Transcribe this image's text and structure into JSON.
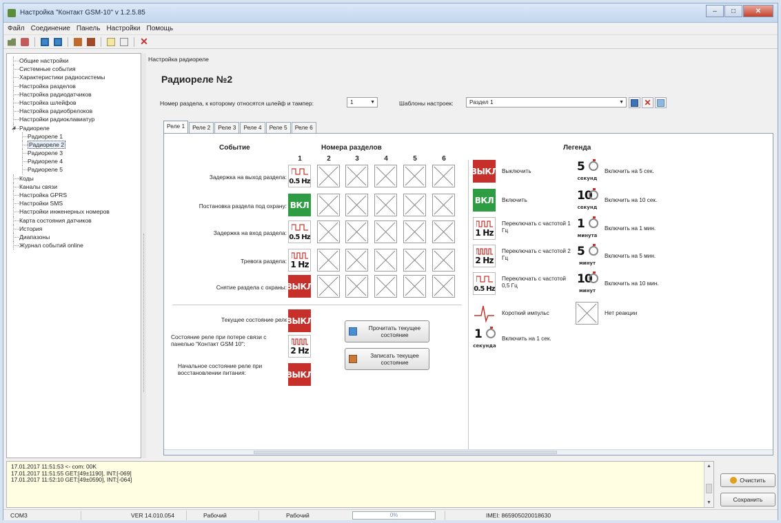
{
  "window": {
    "title": "Настройка \"Контакт GSM-10\" v 1.2.5.85"
  },
  "menu": [
    "Файл",
    "Соединение",
    "Панель",
    "Настройки",
    "Помощь"
  ],
  "toolbar_icons": [
    "open-icon",
    "save-icon",
    "read-icon",
    "write-icon",
    "read-all-icon",
    "write-all-icon",
    "copy-icon",
    "paste-icon",
    "delete-icon"
  ],
  "tree": [
    {
      "label": "Общие настройки",
      "level": 0
    },
    {
      "label": "Системные события",
      "level": 0
    },
    {
      "label": "Характеристики радиосистемы",
      "level": 0
    },
    {
      "label": "Настройка разделов",
      "level": 0
    },
    {
      "label": "Настройка радиодатчиков",
      "level": 0
    },
    {
      "label": "Настройка шлейфов",
      "level": 0
    },
    {
      "label": "Настройка радиобрелоков",
      "level": 0
    },
    {
      "label": "Настройки радиоклавиатур",
      "level": 0
    },
    {
      "label": "Радиореле",
      "level": 0,
      "expanded": true
    },
    {
      "label": "Радиореле 1",
      "level": 1
    },
    {
      "label": "Радиореле 2",
      "level": 1,
      "selected": true
    },
    {
      "label": "Радиореле 3",
      "level": 1
    },
    {
      "label": "Радиореле 4",
      "level": 1
    },
    {
      "label": "Радиореле 5",
      "level": 1
    },
    {
      "label": "Коды",
      "level": 0
    },
    {
      "label": "Каналы связи",
      "level": 0
    },
    {
      "label": "Настройка GPRS",
      "level": 0
    },
    {
      "label": "Настройки SMS",
      "level": 0
    },
    {
      "label": "Настройки инженерных номеров",
      "level": 0
    },
    {
      "label": "Карта состояния датчиков",
      "level": 0
    },
    {
      "label": "История",
      "level": 0
    },
    {
      "label": "Диапазоны",
      "level": 0
    },
    {
      "label": "Журнал событий online",
      "level": 0
    }
  ],
  "content": {
    "breadcrumb": "Настройка радиореле",
    "title": "Радиореле №2",
    "section_label": "Номер раздела, к которому относятся шлейф и тампер:",
    "section_value": "1",
    "templates_label": "Шаблоны настроек:",
    "templates_value": "Раздел 1"
  },
  "tabs": [
    "Реле 1",
    "Реле 2",
    "Реле 3",
    "Реле 4",
    "Реле 5",
    "Реле 6"
  ],
  "grid": {
    "event_header": "Событие",
    "sections_header": "Номера разделов",
    "legend_header": "Легенда",
    "columns": [
      "1",
      "2",
      "3",
      "4",
      "5",
      "6"
    ],
    "rows": [
      {
        "label": "Задержка на выход раздела:",
        "first": "0.5 Hz"
      },
      {
        "label": "Постановка раздела под охрану:",
        "first": "ВКЛ"
      },
      {
        "label": "Задержка на вход раздела:",
        "first": "0.5 Hz"
      },
      {
        "label": "Тревога раздела:",
        "first": "1 Hz"
      },
      {
        "label": "Снятие раздела с охраны:",
        "first": "ВЫКЛ"
      }
    ]
  },
  "state": {
    "current_label": "Текущее состояние реле:",
    "current_value": "ВЫКЛ",
    "lost_label": "Состояние реле при потере связи с панелью \"Контакт GSM 10\":",
    "lost_value": "2 Hz",
    "initial_label": "Начальное состояние реле при восстановлении питания:",
    "initial_value": "ВЫКЛ",
    "read_button": "Прочитать текущее состояние",
    "write_button": "Записать текущее состояние"
  },
  "legend": {
    "left": [
      {
        "icon": "ВЫКЛ",
        "text": "Выключить"
      },
      {
        "icon": "ВКЛ",
        "text": "Включить"
      },
      {
        "icon": "1 Hz",
        "text": "Переключать с частотой 1 Гц"
      },
      {
        "icon": "2 Hz",
        "text": "Переключать с частотой 2 Гц"
      },
      {
        "icon": "0.5 Hz",
        "text": "Переключать с частотой 0,5 Гц"
      },
      {
        "icon": "pulse",
        "text": "Короткий импульс"
      },
      {
        "icon": "1",
        "unit": "секунда",
        "text": "Включить на 1 сек."
      }
    ],
    "right": [
      {
        "icon": "5",
        "unit": "секунд",
        "text": "Включить на 5 сек."
      },
      {
        "icon": "10",
        "unit": "секунд",
        "text": "Включить на 10 сек."
      },
      {
        "icon": "1",
        "unit": "минута",
        "text": "Включить на 1 мин."
      },
      {
        "icon": "5",
        "unit": "минут",
        "text": "Включить на 5 мин."
      },
      {
        "icon": "10",
        "unit": "минут",
        "text": "Включить на 10 мин."
      },
      {
        "icon": "none",
        "text": "Нет реакции"
      }
    ]
  },
  "log": {
    "lines": [
      "17.01.2017 11:51:53 <- com: 00K",
      "17.01.2017 11:51:55 GET:[49±1190], INT:[-069]",
      "17.01.2017 11:52:10 GET:[49±0590], INT:[-064]"
    ],
    "clear_button": "Очистить",
    "save_button": "Сохранить"
  },
  "status": {
    "port": "COM3",
    "version": "VER 14.010.054",
    "mode1": "Рабочий",
    "mode2": "Рабочий",
    "progress": "0%",
    "imei": "IMEI: 865905020018630"
  },
  "colors": {
    "off": "#c7302a",
    "on": "#2d9c42"
  }
}
